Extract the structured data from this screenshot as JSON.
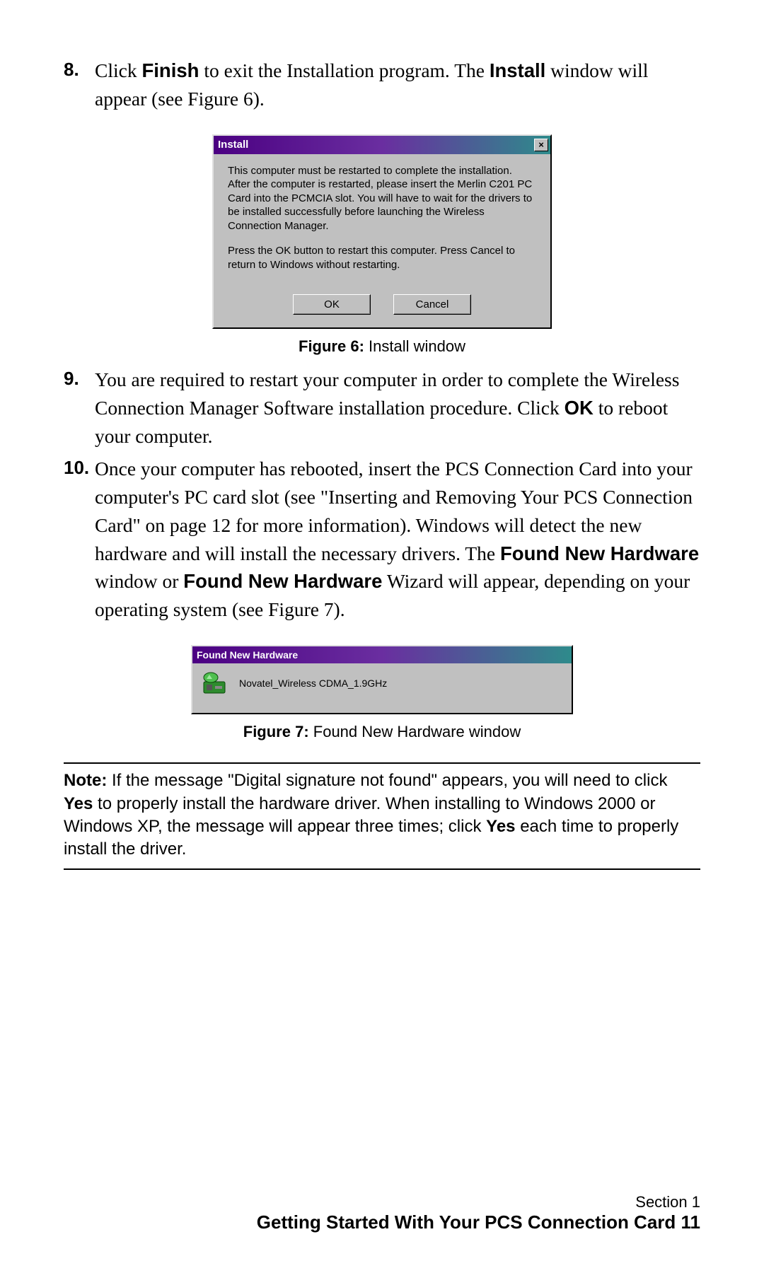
{
  "steps": {
    "s8": {
      "num": "8.",
      "pre": "Click ",
      "b1": "Finish",
      "mid1": " to exit the Installation program. The ",
      "b2": "Install",
      "post": " window will appear (see Figure 6)."
    },
    "s9": {
      "num": "9.",
      "pre": "You are required to restart your computer in order to complete the Wireless Connection Manager Software installation procedure. Click ",
      "b1": "OK",
      "post": " to reboot your computer."
    },
    "s10": {
      "num": "10.",
      "pre": "Once your computer has rebooted, insert the PCS Connection Card into your computer's PC card slot (see \"Inserting and Removing Your PCS Connection Card\" on page 12 for more information). Windows will detect the new hardware and will install the necessary drivers. The ",
      "b1": "Found New Hardware",
      "mid1": " window or ",
      "b2": "Found New Hardware",
      "post": " Wizard will appear, depending on your operating system (see Figure 7)."
    }
  },
  "fig6": {
    "title": "Install",
    "close": "×",
    "p1": "This computer must be restarted to complete the installation. After the computer is restarted, please insert the Merlin C201 PC Card into the PCMCIA slot. You will have to wait for the drivers to be installed successfully before launching the Wireless Connection Manager.",
    "p2": "Press the OK button to restart this computer. Press Cancel to return to Windows without restarting.",
    "ok": "OK",
    "cancel": "Cancel",
    "caption_b": "Figure 6:",
    "caption": " Install window"
  },
  "fig7": {
    "title": "Found New Hardware",
    "device": "Novatel_Wireless CDMA_1.9GHz",
    "caption_b": "Figure 7:",
    "caption": " Found New Hardware window"
  },
  "note": {
    "label": "Note:",
    "t1": " If the message \"Digital signature not found\" appears, you will need to click ",
    "b1": "Yes",
    "t2": " to properly install the hardware driver. When installing to Windows 2000 or Windows XP, the message will appear three times; click ",
    "b2": "Yes",
    "t3": " each time to properly install the driver."
  },
  "footer": {
    "section": "Section 1",
    "title": "Getting Started With Your PCS Connection Card    11"
  }
}
